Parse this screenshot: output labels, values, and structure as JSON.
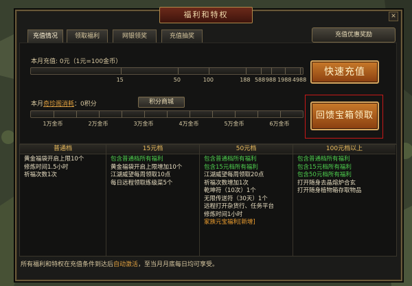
{
  "title": "福利和特权",
  "tabs": [
    {
      "label": "充值情况"
    },
    {
      "label": "领取福利"
    },
    {
      "label": "网银领奖"
    },
    {
      "label": "充值抽奖"
    }
  ],
  "bonus_tab": "充值优惠奖励",
  "recharge": {
    "prefix": "本月充值:",
    "value": "0元（1元=100金币）",
    "ticks": [
      "15",
      "50",
      "100",
      "188",
      "588",
      "988",
      "1988",
      "4988"
    ],
    "progress": 0
  },
  "consume": {
    "prefix": "本月",
    "link": "奇珍阁消耗",
    "value": "：0积分",
    "shop_button": "积分商城",
    "ticks": [
      "1万金币",
      "2万金币",
      "3万金币",
      "4万金币",
      "5万金币",
      "6万金币"
    ],
    "progress": 0
  },
  "buttons": {
    "quick_recharge": "快速充值",
    "chest_claim": "回馈宝箱领取"
  },
  "tiers": [
    {
      "header": "普通档",
      "lines": [
        {
          "text": "黄金福袋开启上限10个",
          "color": "white"
        },
        {
          "text": "修炼时间1.5小时",
          "color": "white"
        },
        {
          "text": "祈福次数1次",
          "color": "white"
        }
      ]
    },
    {
      "header": "15元档",
      "lines": [
        {
          "text": "包含普通档所有福利",
          "color": "green"
        },
        {
          "text": "黄金福袋开启上限增加10个",
          "color": "white"
        },
        {
          "text": "江湖威望每周领取10点",
          "color": "white"
        },
        {
          "text": "每日远程领取练级菜5个",
          "color": "white"
        }
      ]
    },
    {
      "header": "50元档",
      "lines": [
        {
          "text": "包含普通档所有福利",
          "color": "green"
        },
        {
          "text": "包含15元档所有福利",
          "color": "green"
        },
        {
          "text": "江湖威望每周领取20点",
          "color": "white"
        },
        {
          "text": "祈福次数增加1次",
          "color": "white"
        },
        {
          "text": "乾坤符（10次）1个",
          "color": "white"
        },
        {
          "text": "无限传送符（30天）1个",
          "color": "white"
        },
        {
          "text": "远程打开杂货行、任务平台",
          "color": "white"
        },
        {
          "text": "修炼时间1小时",
          "color": "white"
        },
        {
          "text": "家族元宝福利[新增]",
          "color": "orange"
        }
      ]
    },
    {
      "header": "100元档以上",
      "lines": [
        {
          "text": "包含普通档所有福利",
          "color": "green"
        },
        {
          "text": "包含15元档所有福利",
          "color": "green"
        },
        {
          "text": "包含50元档所有福利",
          "color": "green"
        },
        {
          "text": "打开随身去晶熔炉合玄",
          "color": "white"
        },
        {
          "text": "打开随身植物箱存取物品",
          "color": "white"
        }
      ]
    }
  ],
  "footer": {
    "before": "所有福利和特权在充值条件到达后",
    "highlight": "自动激活",
    "after": "，至当月月底每日均可享受。"
  },
  "colors": {
    "accent": "#c48a2a",
    "green": "#4fd04f",
    "orange": "#f0a030",
    "highlight_frame": "#c81818"
  },
  "icons": {
    "close": "close-icon"
  }
}
